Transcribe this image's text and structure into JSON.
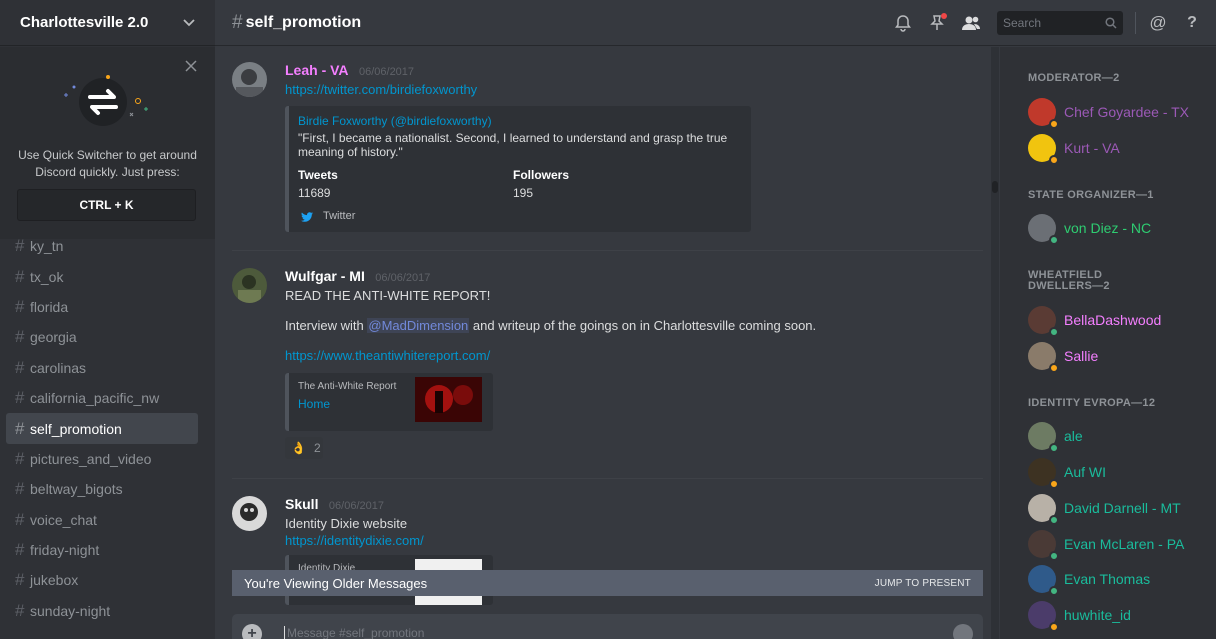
{
  "server": {
    "name": "Charlottesville 2.0"
  },
  "quick_switcher": {
    "text": "Use Quick Switcher to get around Discord quickly. Just press:",
    "shortcut": "CTRL + K"
  },
  "channels": [
    "ky_tn",
    "tx_ok",
    "florida",
    "georgia",
    "carolinas",
    "california_pacific_nw",
    "self_promotion",
    "pictures_and_video",
    "beltway_bigots",
    "voice_chat",
    "friday-night",
    "jukebox",
    "sunday-night"
  ],
  "active_channel": "self_promotion",
  "header": {
    "channel": "self_promotion",
    "search_placeholder": "Search"
  },
  "messages": [
    {
      "author": "Leah - VA",
      "author_color": "#f47fff",
      "timestamp": "06/06/2017",
      "link": "https://twitter.com/birdiefoxworthy",
      "embed": {
        "title": "Birdie Foxworthy (@birdiefoxworthy)",
        "description": "\"First, I became a nationalist. Second, I learned to understand and grasp the true meaning of history.\"",
        "field1_name": "Tweets",
        "field1_value": "11689",
        "field2_name": "Followers",
        "field2_value": "195",
        "footer": "Twitter"
      }
    },
    {
      "author": "Wulfgar - MI",
      "author_color": "#ffffff",
      "timestamp": "06/06/2017",
      "line1": "READ THE ANTI-WHITE REPORT!",
      "line2_pre": "Interview with ",
      "mention": "@MadDimension",
      "line2_post": " and writeup of the goings on in Charlottesville coming soon.",
      "link": "https://www.theantiwhitereport.com/",
      "embed": {
        "provider": "The Anti-White Report",
        "title": "Home"
      },
      "reaction": {
        "emoji": "👌",
        "count": "2"
      }
    },
    {
      "author": "Skull",
      "author_color": "#ffffff",
      "timestamp": "06/06/2017",
      "text": "Identity Dixie website",
      "link": "https://identitydixie.com/",
      "embed": {
        "provider": "Identity Dixie"
      }
    }
  ],
  "older_banner": {
    "text": "You're Viewing Older Messages",
    "jump": "JUMP TO PRESENT"
  },
  "composer": {
    "placeholder": "Message #self_promotion"
  },
  "member_groups": [
    {
      "role": "MODERATOR—2",
      "members": [
        {
          "name": "Chef Goyardee - TX",
          "color": "#9b59b6",
          "status": "#faa61a",
          "avatar": "#c0392b"
        },
        {
          "name": "Kurt - VA",
          "color": "#9b59b6",
          "status": "#faa61a",
          "avatar": "#f1c40f"
        }
      ]
    },
    {
      "role": "STATE ORGANIZER—1",
      "members": [
        {
          "name": "von Diez - NC",
          "color": "#2ecc71",
          "status": "#43b581",
          "avatar": "#6b6f75"
        }
      ]
    },
    {
      "role": "WHEATFIELD DWELLERS—2",
      "members": [
        {
          "name": "BellaDashwood",
          "color": "#f47fff",
          "status": "#43b581",
          "avatar": "#5a3b34"
        },
        {
          "name": "Sallie",
          "color": "#f47fff",
          "status": "#faa61a",
          "avatar": "#8a7b6a"
        }
      ]
    },
    {
      "role": "IDENTITY EVROPA—12",
      "members": [
        {
          "name": "ale",
          "color": "#1abc9c",
          "status": "#43b581",
          "avatar": "#6d7b63"
        },
        {
          "name": "Auf WI",
          "color": "#1abc9c",
          "status": "#faa61a",
          "avatar": "#3d3222"
        },
        {
          "name": "David Darnell - MT",
          "color": "#1abc9c",
          "status": "#43b581",
          "avatar": "#b8b1a7"
        },
        {
          "name": "Evan McLaren - PA",
          "color": "#1abc9c",
          "status": "#43b581",
          "avatar": "#4a3a36"
        },
        {
          "name": "Evan Thomas",
          "color": "#1abc9c",
          "status": "#43b581",
          "avatar": "#2f5a8a"
        },
        {
          "name": "huwhite_id",
          "color": "#1abc9c",
          "status": "#faa61a",
          "avatar": "#4b3c6a"
        }
      ]
    }
  ]
}
